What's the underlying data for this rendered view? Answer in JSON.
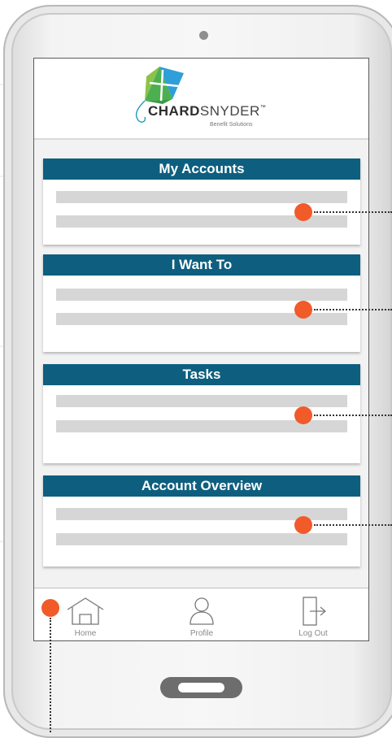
{
  "app": {
    "brand_bold": "CHARD",
    "brand_regular": "SNYDER",
    "trademark": "™",
    "tagline": "Benefit Solutions"
  },
  "panels": [
    {
      "title": "My Accounts"
    },
    {
      "title": "I Want To"
    },
    {
      "title": "Tasks"
    },
    {
      "title": "Account Overview"
    }
  ],
  "nav": {
    "home": {
      "label": "Home",
      "icon": "home-icon"
    },
    "profile": {
      "label": "Profile",
      "icon": "user-icon"
    },
    "logout": {
      "label": "Log Out",
      "icon": "logout-icon"
    }
  },
  "colors": {
    "panel_header": "#0e5f7f",
    "annotation_dot": "#f15a29",
    "placeholder_line": "#d6d6d6"
  }
}
